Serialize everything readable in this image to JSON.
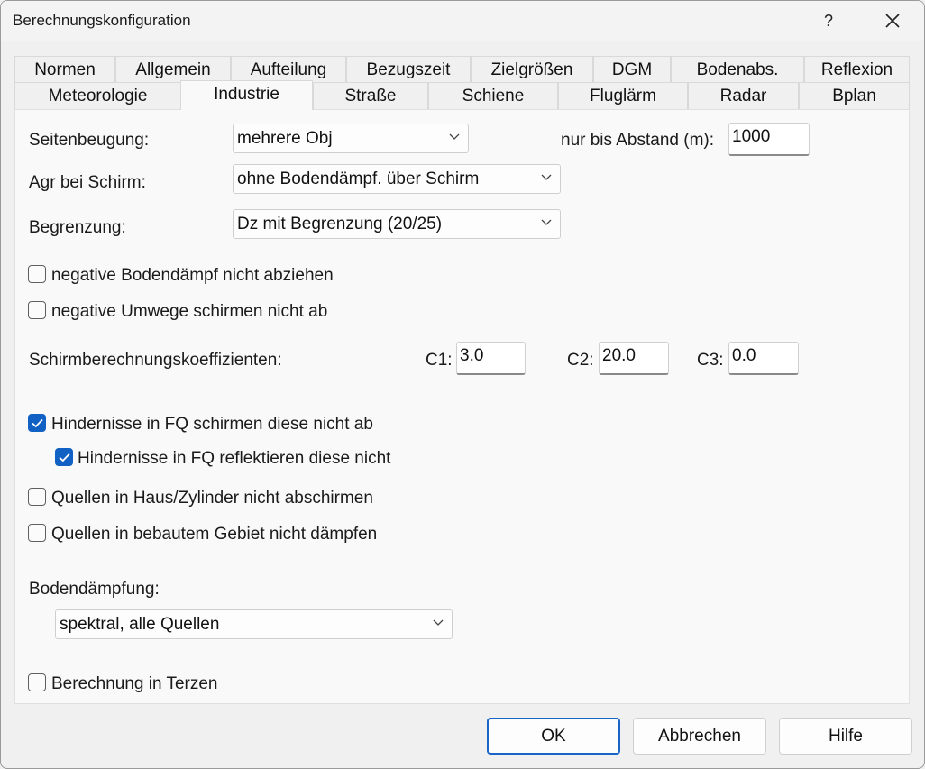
{
  "window": {
    "title": "Berechnungskonfiguration",
    "help_label": "?"
  },
  "tabs": {
    "row1": [
      "Normen",
      "Allgemein",
      "Aufteilung",
      "Bezugszeit",
      "Zielgrößen",
      "DGM",
      "Bodenabs.",
      "Reflexion"
    ],
    "row2": [
      "Meteorologie",
      "Industrie",
      "Straße",
      "Schiene",
      "Fluglärm",
      "Radar",
      "Bplan"
    ],
    "active": "Industrie"
  },
  "form": {
    "seitenbeugung_label": "Seitenbeugung:",
    "seitenbeugung_value": "mehrere Obj",
    "abstand_label": "nur bis Abstand (m):",
    "abstand_value": "1000",
    "agr_label": "Agr bei Schirm:",
    "agr_value": "ohne Bodendämpf. über Schirm",
    "begrenzung_label": "Begrenzung:",
    "begrenzung_value": "Dz mit Begrenzung (20/25)",
    "neg_bodendaempf_label": "negative Bodendämpf nicht abziehen",
    "neg_umwege_label": "negative Umwege schirmen nicht ab",
    "schirm_koeff_label": "Schirmberechnungskoeffizienten:",
    "c1_label": "C1:",
    "c1_value": "3.0",
    "c2_label": "C2:",
    "c2_value": "20.0",
    "c3_label": "C3:",
    "c3_value": "0.0",
    "hindernisse_schirmen_label": "Hindernisse in FQ schirmen diese nicht ab",
    "hindernisse_reflektieren_label": "Hindernisse in FQ reflektieren diese nicht",
    "quellen_haus_label": "Quellen in Haus/Zylinder nicht abschirmen",
    "quellen_bebaut_label": "Quellen in bebautem Gebiet nicht dämpfen",
    "bodendaempfung_label": "Bodendämpfung:",
    "bodendaempfung_value": "spektral, alle Quellen",
    "terzen_label": "Berechnung in Terzen"
  },
  "checkboxes": {
    "neg_bodendaempf": false,
    "neg_umwege": false,
    "hindernisse_schirmen": true,
    "hindernisse_reflektieren": true,
    "quellen_haus": false,
    "quellen_bebaut": false,
    "terzen": false
  },
  "buttons": {
    "ok": "OK",
    "cancel": "Abbrechen",
    "help": "Hilfe"
  },
  "colors": {
    "accent": "#1160c4"
  }
}
